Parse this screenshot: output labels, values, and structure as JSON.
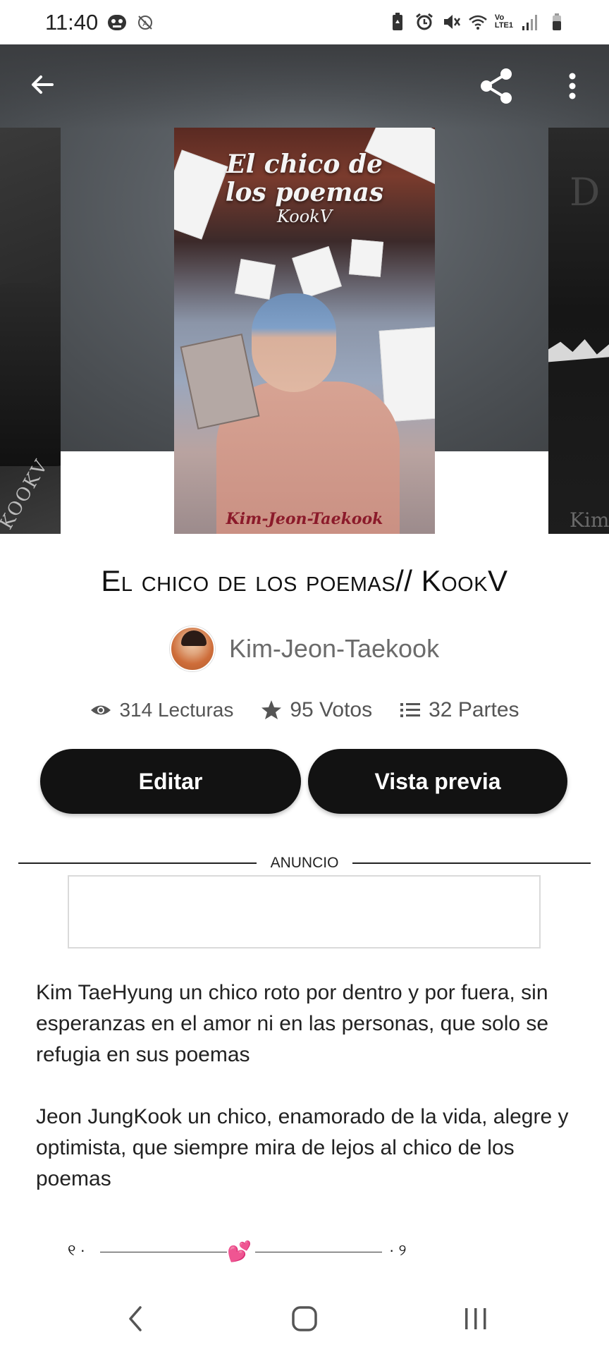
{
  "status_bar": {
    "time": "11:40",
    "network_label_top": "Vo",
    "network_label_bottom": "LTE1",
    "icons": [
      "piko-app-icon",
      "autorotate-off-icon",
      "battery-saver-icon",
      "alarm-icon",
      "mute-icon",
      "wifi-icon",
      "signal-icon",
      "battery-icon"
    ]
  },
  "toolbar": {
    "back_icon": "arrow-left-icon",
    "share_icon": "share-icon",
    "more_icon": "more-vertical-icon"
  },
  "cover": {
    "title_line1": "El chico de",
    "title_line2": "los poemas",
    "subtitle": "KookV",
    "author_line": "Kim-Jeon-Taekook"
  },
  "side_covers": {
    "left_text": "KOOKV",
    "right_text_top": "D",
    "right_text_bottom": "Kim"
  },
  "story": {
    "title": "El chico de los poemas// KookV",
    "author": "Kim-Jeon-Taekook"
  },
  "stats": {
    "reads": "314 Lecturas",
    "votes": "95 Votos",
    "parts": "32 Partes"
  },
  "actions": {
    "edit_label": "Editar",
    "preview_label": "Vista previa"
  },
  "ad": {
    "label": "ANUNCIO"
  },
  "description": {
    "paragraph1": "Kim TaeHyung un chico roto por dentro y por fuera, sin esperanzas en el amor ni en las personas, que solo se refugia en sus poemas",
    "paragraph2": "Jeon JungKook un chico, enamorado de la vida, alegre y optimista, que siempre mira de lejos al chico de los poemas"
  },
  "ornament": {
    "left_mark": "୧ ·",
    "right_mark": "· ୨",
    "heart": "💕"
  },
  "colors": {
    "button_bg": "#121212",
    "button_text": "#ffffff",
    "muted_text": "#6b6b6b"
  }
}
